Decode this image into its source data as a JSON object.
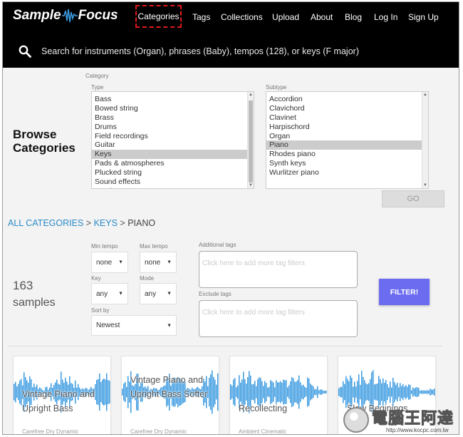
{
  "header": {
    "logo_left": "Sample",
    "logo_right": "Focus",
    "nav": [
      "Categories",
      "Tags",
      "Collections",
      "Upload",
      "About",
      "Blog",
      "Log In",
      "Sign Up"
    ]
  },
  "search": {
    "placeholder": "Search for instruments (Organ), phrases (Baby), tempos (128), or keys (F major)"
  },
  "browse": {
    "title_line1": "Browse",
    "title_line2": "Categories",
    "category_label": "Category",
    "type_label": "Type",
    "subtype_label": "Subtype",
    "types": [
      "Bass",
      "Bowed string",
      "Brass",
      "Drums",
      "Field recordings",
      "Guitar",
      "Keys",
      "Pads & atmospheres",
      "Plucked string",
      "Sound effects",
      "Synth..."
    ],
    "selected_type": "Keys",
    "subtypes": [
      "Accordion",
      "Clavichord",
      "Clavinet",
      "Harpischord",
      "Organ",
      "Piano",
      "Rhodes piano",
      "Synth keys",
      "Wurlitzer piano"
    ],
    "selected_subtype": "Piano",
    "go_label": "GO"
  },
  "breadcrumb": {
    "all": "ALL CATEGORIES",
    "sep": ">",
    "keys": "KEYS",
    "current": "PIANO"
  },
  "results": {
    "count": "163",
    "label": "samples"
  },
  "filters": {
    "min_tempo_label": "Min tempo",
    "min_tempo": "none",
    "max_tempo_label": "Max tempo",
    "max_tempo": "none",
    "key_label": "Key",
    "key": "any",
    "mode_label": "Mode",
    "mode": "any",
    "sort_label": "Sort by",
    "sort": "Newest",
    "additional_tags_label": "Additional tags",
    "additional_tags_placeholder": "Click here to add more tag filters",
    "exclude_tags_label": "Exclude tags",
    "exclude_tags_placeholder": "Click here to add more tag filters",
    "filter_label": "FILTER!"
  },
  "cards": [
    {
      "title": "Vintage Piano and Upright Bass",
      "tags": "Carefree   Dry   Dynamic"
    },
    {
      "title": "Vintage Piano and Upright Bass Softer",
      "tags": "Carefree   Dry   Dynamic"
    },
    {
      "title": "Recollecting",
      "tags": "Ambient   Cinematic"
    },
    {
      "title": "Slow Beginings",
      "tags": ""
    }
  ],
  "watermark": {
    "text": "電腦王阿達",
    "url": "http://www.kocpc.com.tw"
  },
  "colors": {
    "accent": "#6b6cf0",
    "link": "#2a8bc7",
    "wave": "#3a9ae0",
    "highlight": "#e01a1a"
  }
}
